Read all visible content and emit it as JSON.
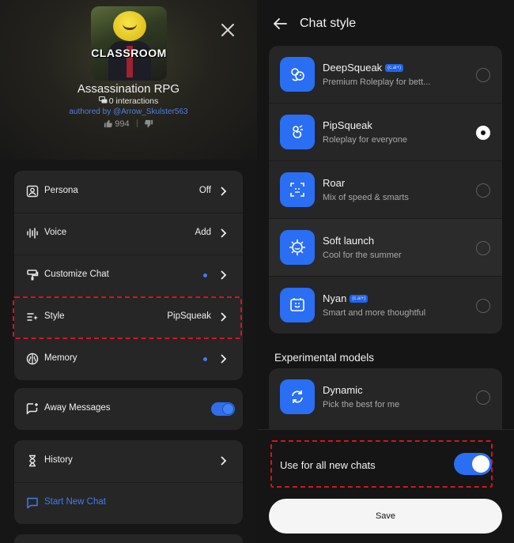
{
  "bot": {
    "cover_title": "CLASSROOM",
    "name": "Assassination RPG",
    "interactions": "0 interactions",
    "author": "authored by @Arrow_Skulster563",
    "likes": "994"
  },
  "settings": {
    "persona": {
      "label": "Persona",
      "value": "Off"
    },
    "voice": {
      "label": "Voice",
      "value": "Add"
    },
    "customize_chat": {
      "label": "Customize Chat"
    },
    "style": {
      "label": "Style",
      "value": "PipSqueak"
    },
    "memory": {
      "label": "Memory"
    },
    "away_messages": {
      "label": "Away Messages",
      "enabled": true
    },
    "history": {
      "label": "History"
    },
    "start_new_chat": {
      "label": "Start New Chat"
    }
  },
  "chat_style": {
    "title": "Chat style",
    "models": [
      {
        "name": "DeepSqueak",
        "tag": "(c.ai+)",
        "desc": "Premium Roleplay for bett...",
        "selected": false
      },
      {
        "name": "PipSqueak",
        "desc": "Roleplay for everyone",
        "selected": true
      },
      {
        "name": "Roar",
        "desc": "Mix of speed & smarts",
        "selected": false
      },
      {
        "name": "Soft launch",
        "desc": "Cool for the summer",
        "selected": false
      },
      {
        "name": "Nyan",
        "tag": "(c.ai+)",
        "desc": "Smart and more thoughtful",
        "selected": false
      }
    ],
    "experimental_title": "Experimental models",
    "experimental": [
      {
        "name": "Dynamic",
        "desc": "Pick the best for me",
        "selected": false
      }
    ],
    "use_for_all_label": "Use for all new chats",
    "use_for_all_enabled": true,
    "save_label": "Save"
  },
  "colors": {
    "accent": "#2a6ef3",
    "link": "#4f7fe6",
    "highlight": "#d0161c"
  }
}
